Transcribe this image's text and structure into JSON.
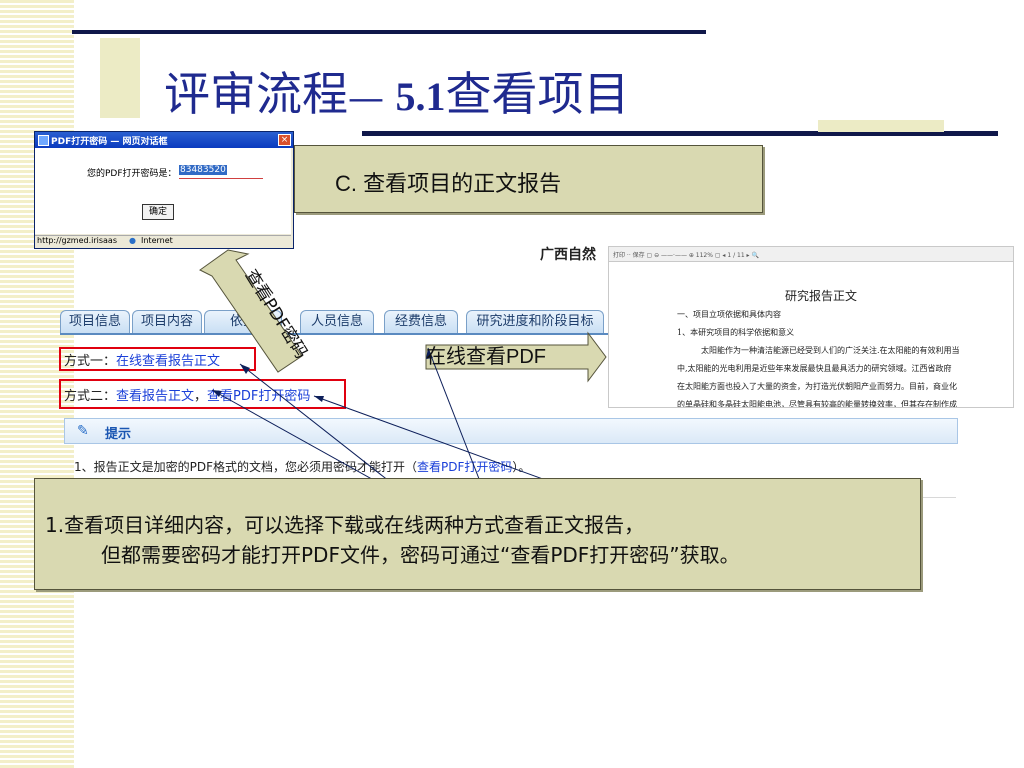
{
  "slide": {
    "title_cn": "评审流程",
    "title_dash": "— ",
    "title_num": "5.1",
    "title_rest": "查看项目",
    "box_c": "C. 查看项目的正文报告",
    "online_label": "在线查看PDF",
    "diag_label": "查看PDF密码",
    "note_line1": "1.查看项目详细内容，可以选择下载或在线两种方式查看正文报告，",
    "note_line2": "但都需要密码才能打开PDF文件，密码可通过“查看PDF打开密码”获取。"
  },
  "dialog": {
    "title": "PDF打开密码 — 网页对话框",
    "close": "×",
    "label": "您的PDF打开密码是：",
    "password": "83483520",
    "ok": "确定",
    "url": "http://gzmed.irisaas",
    "zone": "Internet"
  },
  "page": {
    "header_title": "广西自然",
    "tabs": [
      "项目信息",
      "项目内容",
      "依托",
      "人员信息",
      "经费信息",
      "研究进度和阶段目标"
    ],
    "opt1_label": "方式一：",
    "opt1_link": "在线查看报告正文",
    "opt2_label": "方式二：",
    "opt2_link1": "查看报告正文",
    "opt2_sep": "，",
    "opt2_link2": "查看PDF打开密码",
    "tip_title": "提示",
    "tip_text": "1、报告正文是加密的PDF格式的文档，您必须用密码才能打开（",
    "tip_link": "查看PDF打开密码",
    "tip_end": "）。"
  },
  "pdf": {
    "toolbar": "打印 ·· 保存 ▢  ⊖ ——·—— ⊕  112%  ▢  ◂  1  /  11  ▸        🔍",
    "heading": "研究报告正文",
    "lines": [
      "一、项目立项依据和具体内容",
      "1、本研究项目的科学依据和意义",
      "太阳能作为一种清洁能源已经受到人们的广泛关注.在太阳能的有效利用当",
      "中,太阳能的光电利用是近些年来发展最快且最具活力的研究领域。江西省政府",
      "在太阳能方面也投入了大量的资金，为打造光伏朝阳产业而努力。目前，商业化",
      "的单晶硅和多晶硅太阳能电池，尽管具有较高的能量转换效率，但其存在制作成"
    ]
  },
  "colors": {
    "title": "#1f2a8f",
    "rule": "#10184a",
    "note_bg": "#d9d9b1",
    "red_box": "#e0000f",
    "link": "#1a3fd8"
  }
}
